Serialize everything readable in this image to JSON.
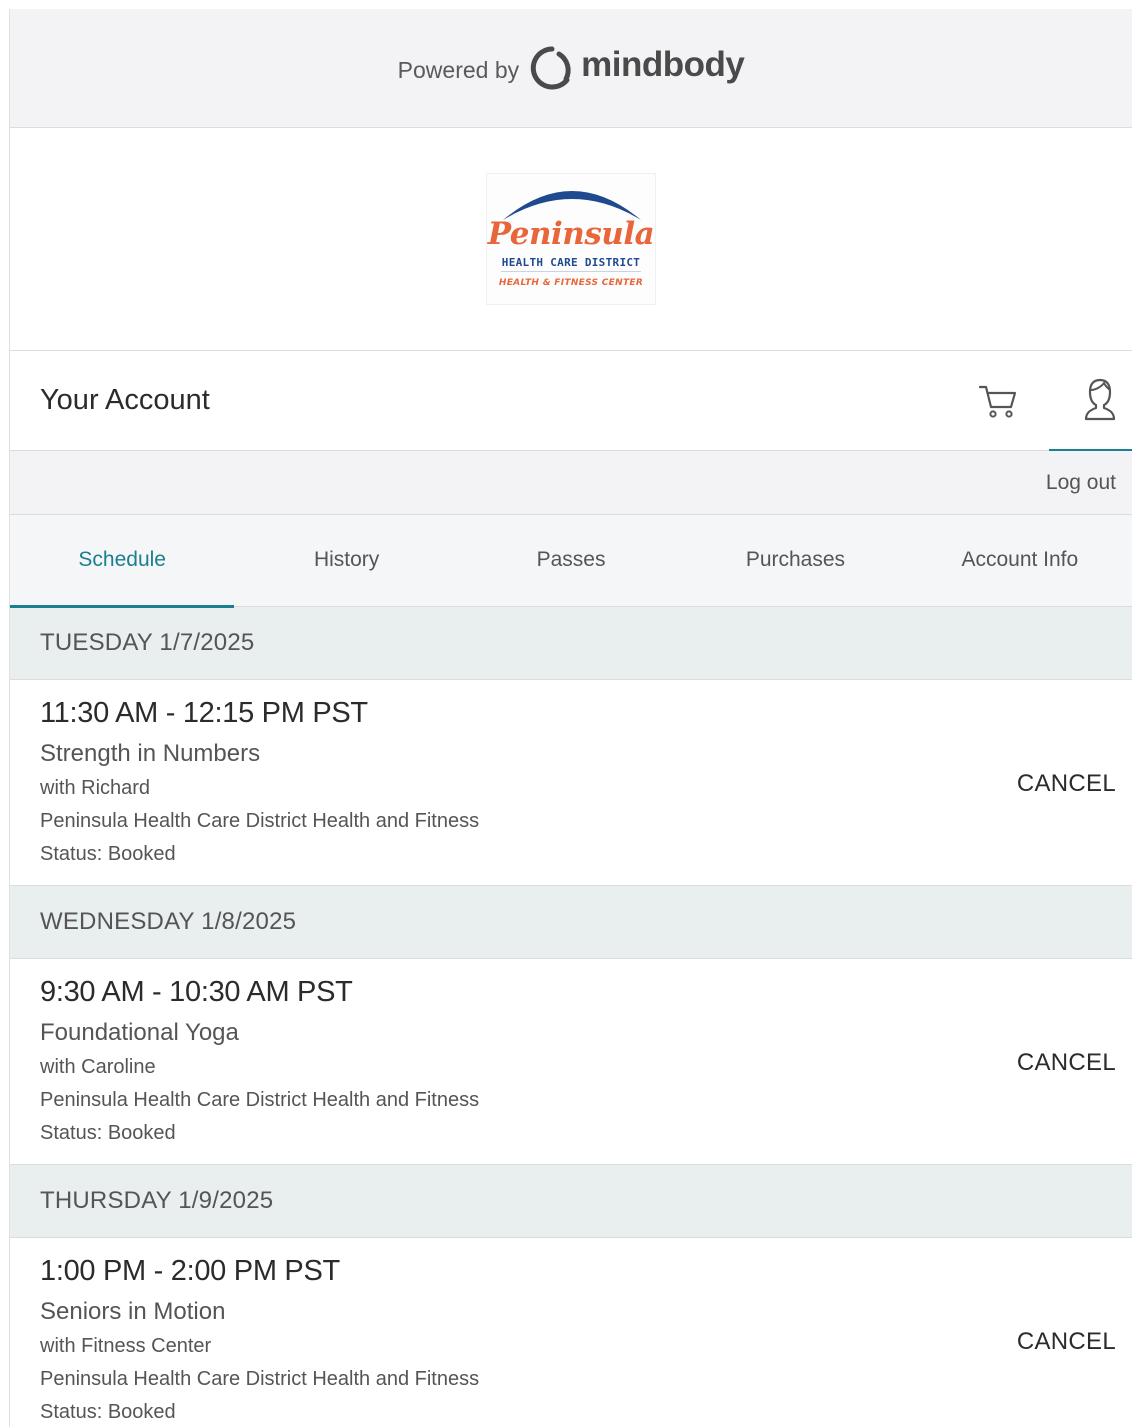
{
  "powered_by": {
    "prefix": "Powered by",
    "brand": "mindbody"
  },
  "studio_logo": {
    "script": "Peninsula",
    "line1": "HEALTH CARE DISTRICT",
    "line2": "HEALTH & FITNESS CENTER"
  },
  "account": {
    "title": "Your Account",
    "cart_icon": "cart-icon",
    "user_icon": "user-icon",
    "logout": "Log out"
  },
  "tabs": [
    {
      "label": "Schedule",
      "active": true
    },
    {
      "label": "History",
      "active": false
    },
    {
      "label": "Passes",
      "active": false
    },
    {
      "label": "Purchases",
      "active": false
    },
    {
      "label": "Account Info",
      "active": false
    }
  ],
  "schedule": [
    {
      "day": "TUESDAY 1/7/2025",
      "time": "11:30 AM - 12:15 PM PST",
      "class_name": "Strength in Numbers",
      "instructor": "with Richard",
      "location": "Peninsula Health Care District Health and Fitness",
      "status": "Status: Booked",
      "action": "CANCEL"
    },
    {
      "day": "WEDNESDAY 1/8/2025",
      "time": "9:30 AM - 10:30 AM PST",
      "class_name": "Foundational Yoga",
      "instructor": "with Caroline",
      "location": "Peninsula Health Care District Health and Fitness",
      "status": "Status: Booked",
      "action": "CANCEL"
    },
    {
      "day": "THURSDAY 1/9/2025",
      "time": "1:00 PM - 2:00 PM PST",
      "class_name": "Seniors in Motion",
      "instructor": "with Fitness Center",
      "location": "Peninsula Health Care District Health and Fitness",
      "status": "Status: Booked",
      "action": "CANCEL"
    }
  ],
  "colors": {
    "accent": "#1a7f8e",
    "logo_orange": "#e8663a",
    "logo_blue": "#1f4a8f"
  }
}
